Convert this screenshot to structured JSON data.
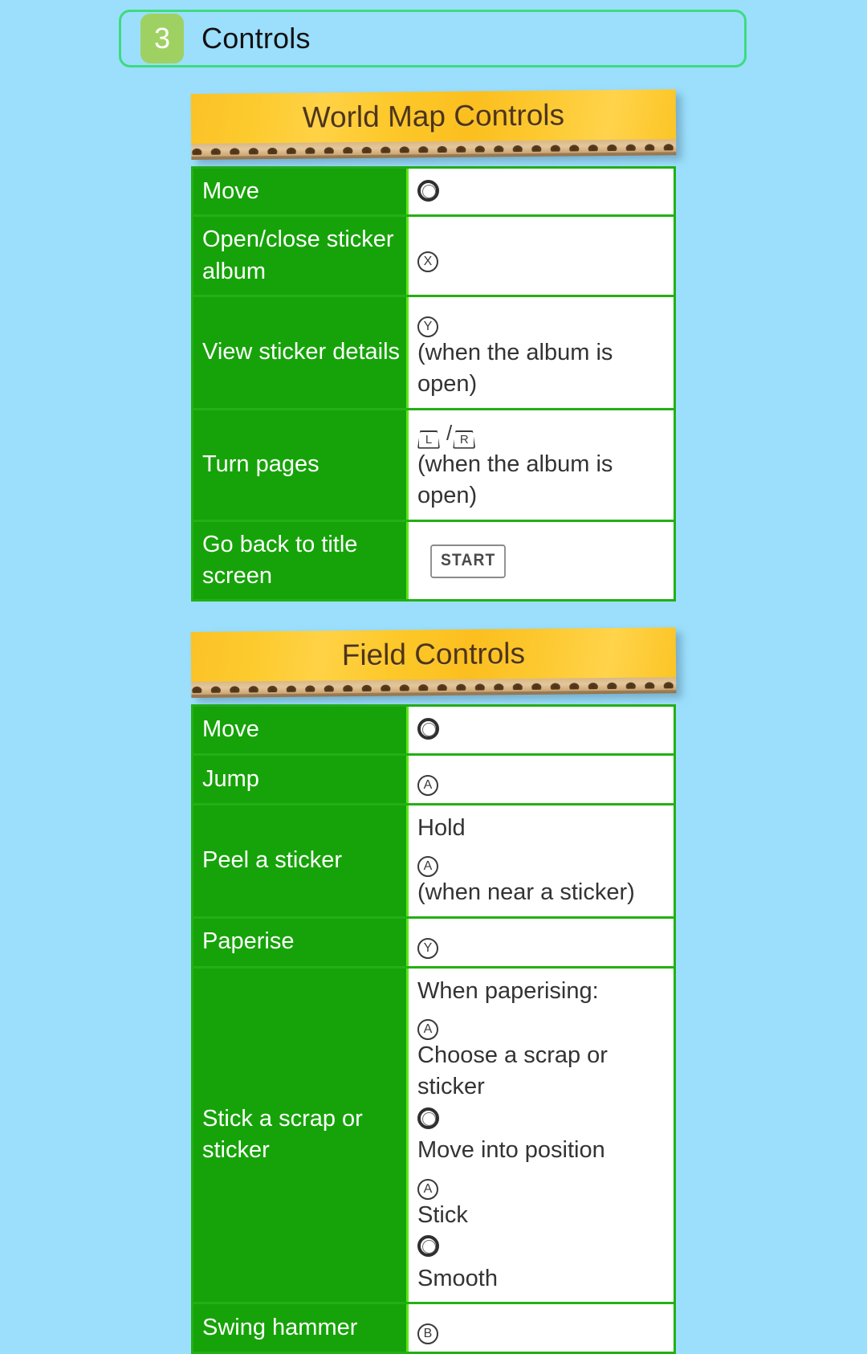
{
  "header": {
    "chapter_number": "3",
    "chapter_title": "Controls"
  },
  "colors": {
    "page_background": "#9bdffc",
    "header_border": "#3ddb7e",
    "badge_green": "#9fd162",
    "table_border": "#22b014",
    "action_cell_green": "#16a309",
    "row_divider_lime": "#5ee616",
    "banner_gold": "#fdc829",
    "banner_text_brown": "#4d3318",
    "cardboard_tan": "#e3c79c"
  },
  "sections": [
    {
      "banner_title": "World Map Controls",
      "rows": [
        {
          "action": "Move",
          "parts": [
            {
              "kind": "circlepad"
            }
          ]
        },
        {
          "action": "Open/close sticker album",
          "parts": [
            {
              "kind": "face",
              "label": "X"
            }
          ]
        },
        {
          "action": "View sticker details",
          "parts": [
            {
              "kind": "face",
              "label": "Y"
            },
            {
              "kind": "text",
              "label": "(when the album is open)"
            }
          ]
        },
        {
          "action": "Turn pages",
          "parts": [
            {
              "kind": "shoulder",
              "label": "L"
            },
            {
              "kind": "slash",
              "label": "/"
            },
            {
              "kind": "shoulder",
              "label": "R"
            },
            {
              "kind": "text",
              "label": "(when the album is open)"
            }
          ]
        },
        {
          "action": "Go back to title screen",
          "parts": [
            {
              "kind": "start",
              "label": "START"
            }
          ]
        }
      ]
    },
    {
      "banner_title": "Field Controls",
      "rows": [
        {
          "action": "Move",
          "parts": [
            {
              "kind": "circlepad"
            }
          ]
        },
        {
          "action": "Jump",
          "parts": [
            {
              "kind": "face",
              "label": "A"
            }
          ]
        },
        {
          "action": "Peel a sticker",
          "parts": [
            {
              "kind": "text",
              "label": "Hold"
            },
            {
              "kind": "face",
              "label": "A"
            },
            {
              "kind": "text",
              "label": "(when near a sticker)"
            }
          ]
        },
        {
          "action": "Paperise",
          "parts": [
            {
              "kind": "face",
              "label": "Y"
            }
          ]
        },
        {
          "action": "Stick a scrap or sticker",
          "lines": [
            {
              "parts": [
                {
                  "kind": "text",
                  "label": "When paperising:"
                }
              ]
            },
            {
              "parts": [
                {
                  "kind": "face",
                  "label": "A"
                },
                {
                  "kind": "text",
                  "label": "Choose a scrap or sticker"
                }
              ]
            },
            {
              "parts": [
                {
                  "kind": "circlepad"
                },
                {
                  "kind": "text",
                  "label": "Move into position"
                }
              ]
            },
            {
              "parts": [
                {
                  "kind": "face",
                  "label": "A"
                },
                {
                  "kind": "text",
                  "label": "Stick"
                }
              ]
            },
            {
              "parts": [
                {
                  "kind": "circlepad"
                },
                {
                  "kind": "text",
                  "label": "Smooth"
                }
              ]
            }
          ]
        },
        {
          "action": "Swing hammer",
          "parts": [
            {
              "kind": "face",
              "label": "B"
            }
          ]
        }
      ]
    }
  ]
}
